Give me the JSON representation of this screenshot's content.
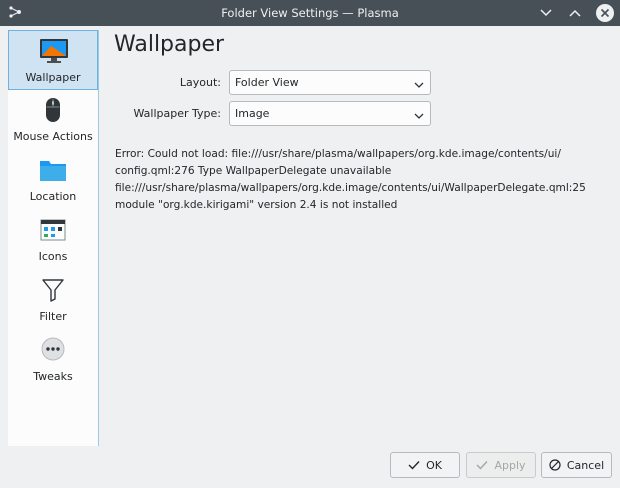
{
  "window": {
    "title": "Folder View Settings — Plasma"
  },
  "sidebar": {
    "items": [
      {
        "label": "Wallpaper",
        "icon": "monitor-icon",
        "active": true
      },
      {
        "label": "Mouse Actions",
        "icon": "mouse-icon",
        "active": false
      },
      {
        "label": "Location",
        "icon": "folder-icon",
        "active": false
      },
      {
        "label": "Icons",
        "icon": "icons-view-icon",
        "active": false
      },
      {
        "label": "Filter",
        "icon": "filter-icon",
        "active": false
      },
      {
        "label": "Tweaks",
        "icon": "more-icon",
        "active": false
      }
    ]
  },
  "main": {
    "title": "Wallpaper",
    "layout_label": "Layout:",
    "layout_value": "Folder View",
    "wallpaper_type_label": "Wallpaper Type:",
    "wallpaper_type_value": "Image",
    "error_lines": [
      "Error: Could not load: file:///usr/share/plasma/wallpapers/org.kde.image/contents/ui/",
      "config.qml:276 Type WallpaperDelegate unavailable",
      "file:///usr/share/plasma/wallpapers/org.kde.image/contents/ui/WallpaperDelegate.qml:25",
      "module \"org.kde.kirigami\" version 2.4 is not installed"
    ]
  },
  "buttons": {
    "ok": "OK",
    "apply": "Apply",
    "cancel": "Cancel"
  },
  "colors": {
    "titlebar": "#475057",
    "selection": "#cfe3f3",
    "accent": "#3daee9"
  }
}
